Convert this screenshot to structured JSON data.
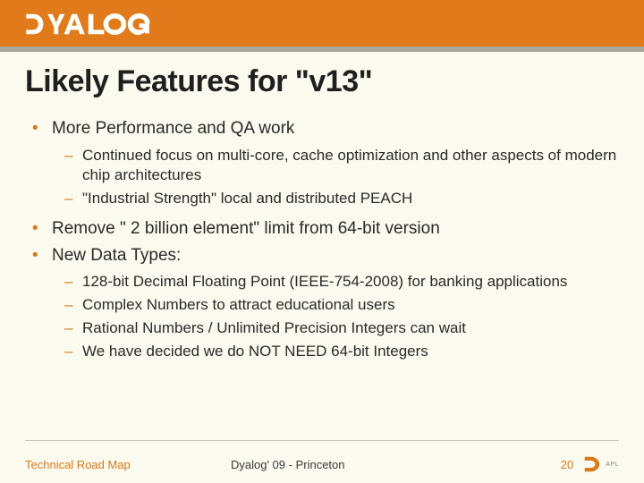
{
  "brand": {
    "name": "DYALOG"
  },
  "slide": {
    "title": "Likely Features for \"v13\"",
    "bullets": [
      {
        "text": "More Performance and QA work",
        "sub": [
          "Continued focus on multi-core, cache optimization and other aspects of modern chip architectures",
          "\"Industrial Strength\" local and distributed PEACH"
        ]
      },
      {
        "text": "Remove \" 2 billion element\" limit from 64-bit version",
        "sub": []
      },
      {
        "text": "New Data Types:",
        "sub": [
          "128-bit Decimal Floating Point (IEEE-754-2008) for banking applications",
          "Complex Numbers to attract educational users",
          "Rational Numbers / Unlimited Precision Integers can wait",
          "We have decided we do NOT NEED 64-bit Integers"
        ]
      }
    ]
  },
  "footer": {
    "left": "Technical Road Map",
    "center": "Dyalog' 09 - Princeton",
    "page": "20",
    "apl_mark": "APL"
  }
}
